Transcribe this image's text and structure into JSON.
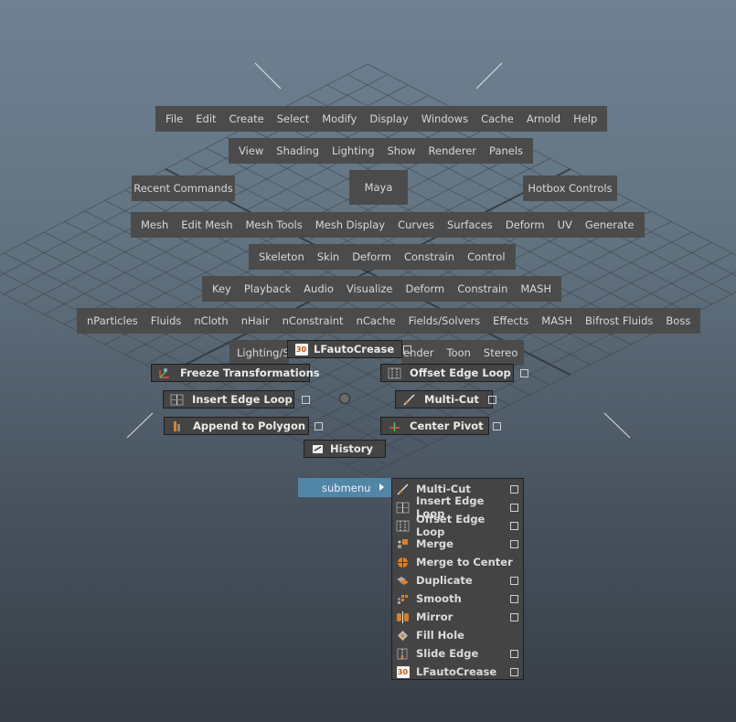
{
  "menubar": [
    "File",
    "Edit",
    "Create",
    "Select",
    "Modify",
    "Display",
    "Windows",
    "Cache",
    "Arnold",
    "Help"
  ],
  "view_row": [
    "View",
    "Shading",
    "Lighting",
    "Show",
    "Renderer",
    "Panels"
  ],
  "recent_commands": "Recent Commands",
  "center_label": "Maya",
  "hotbox_controls": "Hotbox Controls",
  "modeling_row": [
    "Mesh",
    "Edit Mesh",
    "Mesh Tools",
    "Mesh Display",
    "Curves",
    "Surfaces",
    "Deform",
    "UV",
    "Generate"
  ],
  "rigging_row": [
    "Skeleton",
    "Skin",
    "Deform",
    "Constrain",
    "Control"
  ],
  "animation_row": [
    "Key",
    "Playback",
    "Audio",
    "Visualize",
    "Deform",
    "Constrain",
    "MASH"
  ],
  "fx_row": [
    "nParticles",
    "Fluids",
    "nCloth",
    "nHair",
    "nConstraint",
    "nCache",
    "Fields/Solvers",
    "Effects",
    "MASH",
    "Bifrost Fluids",
    "Boss"
  ],
  "rendering_row": {
    "left": "Lighting/S",
    "right": [
      "ender",
      "Toon",
      "Stereo"
    ]
  },
  "marking_menu": {
    "north": "LFautoCrease",
    "north_west": "Freeze Transformations",
    "north_east": "Offset Edge Loop",
    "west": "Insert Edge Loop",
    "east": "Multi-Cut",
    "south_west": "Append to Polygon",
    "south_east": "Center Pivot",
    "south": "History"
  },
  "submenu": {
    "label": "submenu",
    "items": [
      {
        "label": "Multi-Cut",
        "icon": "multi-cut-icon",
        "option_box": true
      },
      {
        "label": "Insert Edge Loop",
        "icon": "insert-edge-loop-icon",
        "option_box": true
      },
      {
        "label": "Offset Edge Loop",
        "icon": "offset-edge-loop-icon",
        "option_box": true
      },
      {
        "label": "Merge",
        "icon": "merge-icon",
        "option_box": true
      },
      {
        "label": "Merge to Center",
        "icon": "merge-to-center-icon",
        "option_box": false
      },
      {
        "label": "Duplicate",
        "icon": "duplicate-icon",
        "option_box": true
      },
      {
        "label": "Smooth",
        "icon": "smooth-icon",
        "option_box": true
      },
      {
        "label": "Mirror",
        "icon": "mirror-icon",
        "option_box": true
      },
      {
        "label": "Fill Hole",
        "icon": "fill-hole-icon",
        "option_box": false
      },
      {
        "label": "Slide Edge",
        "icon": "slide-edge-icon",
        "option_box": true
      },
      {
        "label": "LFautoCrease",
        "icon": "lf-auto-crease-icon",
        "option_box": true
      }
    ]
  },
  "icon_badge_text": "30",
  "colors": {
    "panel": "#4b4b4b",
    "submenu_highlight": "#5286a6",
    "accent_orange": "#d9822b"
  }
}
